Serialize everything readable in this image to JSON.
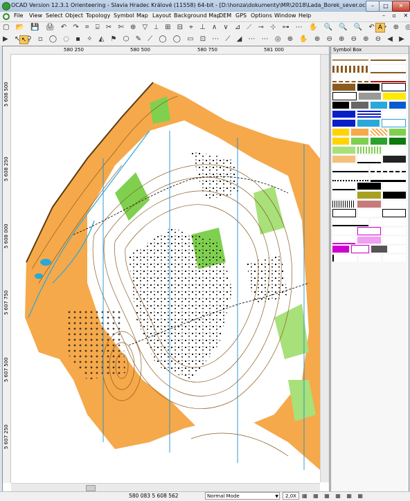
{
  "window": {
    "title": "OCAD Version 12.3.1  Orienteering - Slavia Hradec Králové (11558) 64-bit - [D:\\honza\\dokumenty\\MR\\2018\\Lada_Borek_sever.ocd]",
    "min_label": "–",
    "max_label": "□",
    "close_label": "✕"
  },
  "menu": {
    "items": [
      "File",
      "View",
      "Select",
      "Object",
      "Topology",
      "Symbol",
      "Map",
      "Layout",
      "Background Map",
      "DEM",
      "GPS",
      "Options",
      "Window",
      "Help"
    ],
    "mdi_controls": "– ▫ ✕"
  },
  "toolbar1": {
    "icons": "▢ 📂 💾 🖨  ↶ ↷  ⌗ ⌸  ✂ ✄ ⊕ ▽ ⟂ ⊞ ⊟ ⌖ ⊥ ∧ ∨ ⊿ ⟋ ⊸ ⊹ ⊶ ⋯  ✋ 🔍 🔍 🔍 ↶ ↷ ⊕ ◎",
    "highlight": "A"
  },
  "toolbar2": {
    "icons": "▶ ↖ ⚲ ▫ ◯ ◌ ▪ ✧ ◭ ⚑ ⬡ ✎ ⟋ ◯ ◯ ▭ ⊡ ⋯ ⟋ ◢ ⋯ ⋯ ◎ ⊕ ✋ ⊕ ⊖ ⊕ ⊖ ⊕ ⊖ ◀ ▶ ⊛"
  },
  "ruler": {
    "x_ticks": [
      "580 250",
      "580 500",
      "580 750",
      "581 000"
    ],
    "y_ticks": [
      "5 608 500",
      "5 608 250",
      "5 608 000",
      "5 607 750",
      "5 607 500",
      "5 607 250"
    ]
  },
  "symbol_box": {
    "title": "Symbol Box"
  },
  "status": {
    "coords": "580 083   5 608 562",
    "mode": "Normal Mode",
    "zoom": "2,0X",
    "icons": "▦ ▦ ▦ ▦ ▦ ▦"
  },
  "colors": {
    "map_orange": "#f5a94a",
    "map_green": "#7fd04f",
    "map_contour": "#8a5a1f",
    "map_water": "#29a8d9",
    "map_north_lines": "#1d8fd0"
  }
}
